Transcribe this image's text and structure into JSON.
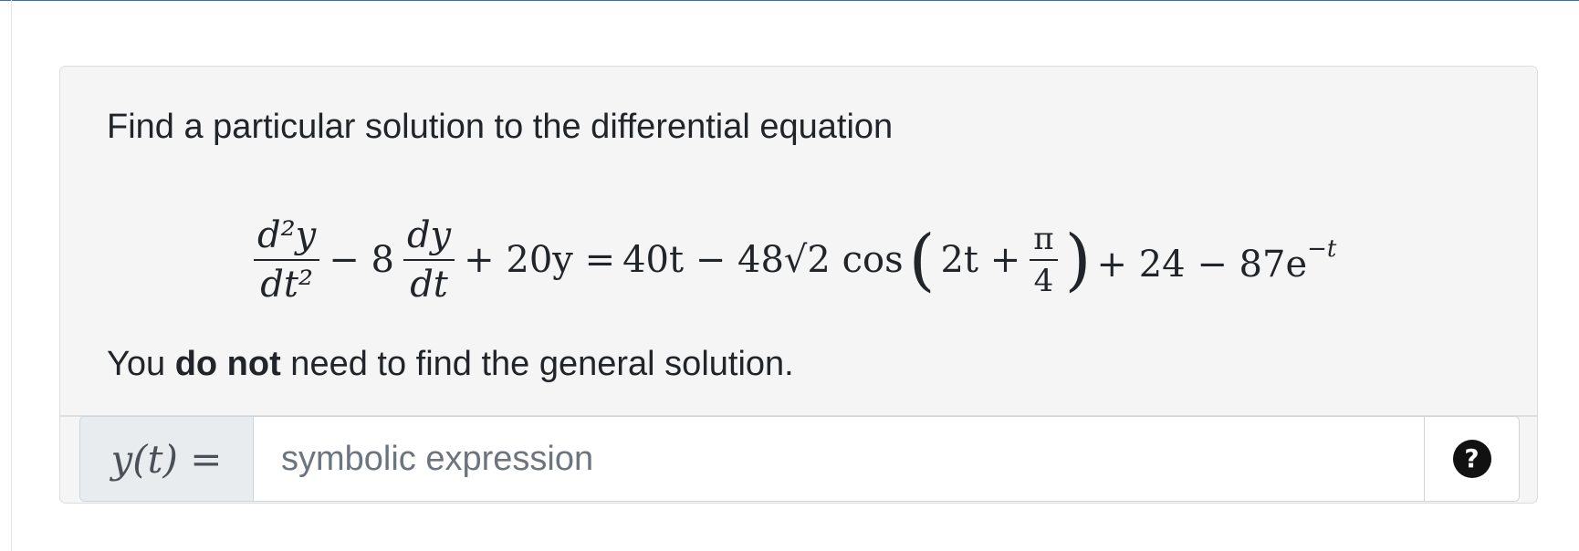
{
  "question": {
    "prompt": "Find a particular solution to the differential equation",
    "equation": {
      "lhs_frac1_num": "d²y",
      "lhs_frac1_den": "dt²",
      "minus_8": "− 8",
      "lhs_frac2_num": "dy",
      "lhs_frac2_den": "dt",
      "rest_lhs": "+ 20y =",
      "rhs_part1": "40t − 48√2 cos",
      "rhs_inner": "2t +",
      "pi_num": "π",
      "pi_den": "4",
      "rhs_part2": "+ 24 − 87e",
      "rhs_exponent": "−t"
    },
    "followup_pre": "You ",
    "followup_bold": "do not",
    "followup_post": " need to find the general solution."
  },
  "answer": {
    "prefix_label": "y(t) =",
    "placeholder": "symbolic expression",
    "help_icon": "question-circle-icon"
  },
  "colors": {
    "card_background": "#f5f5f5",
    "accent_rule": "#2f6fcf"
  }
}
